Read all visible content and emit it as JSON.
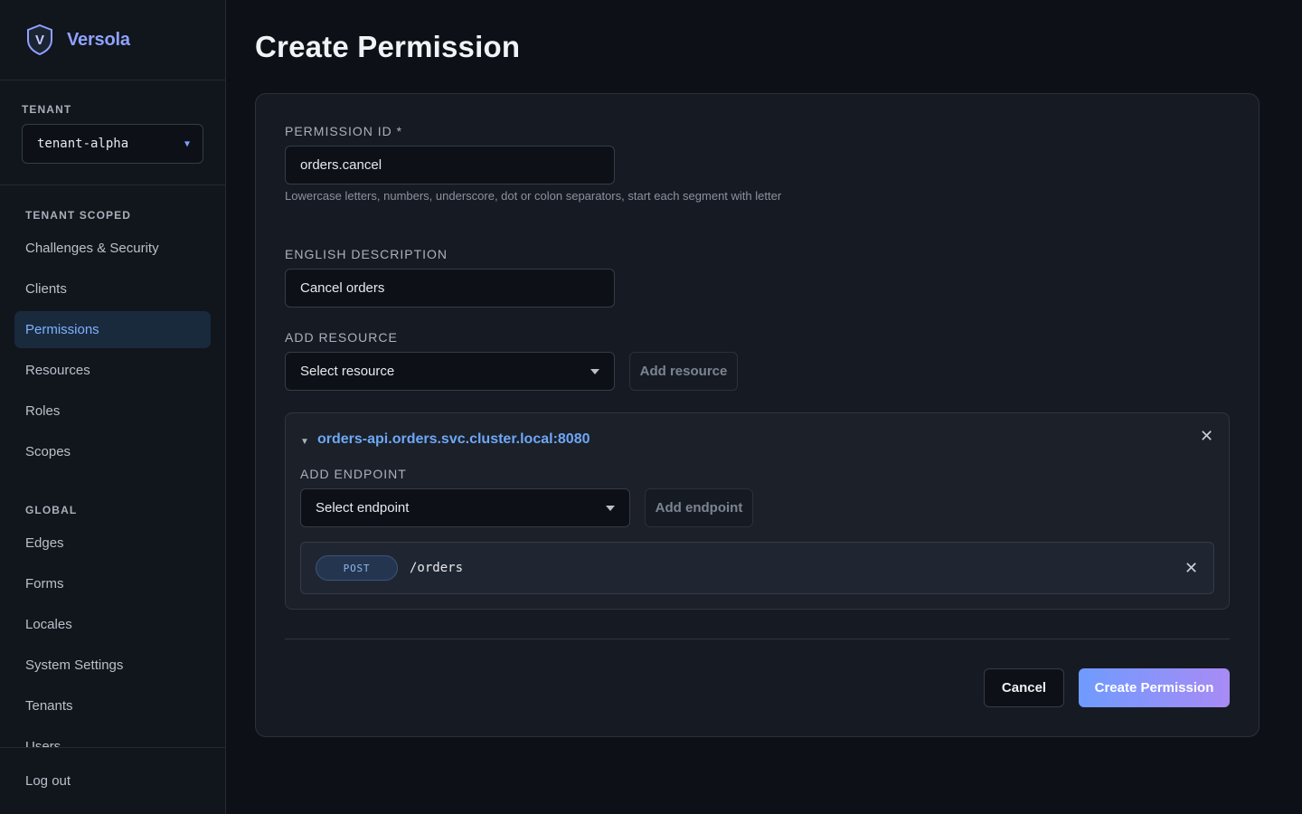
{
  "brand": {
    "name": "Versola",
    "logo_letter": "V",
    "accent": "#8ea2ff"
  },
  "tenant": {
    "label": "TENANT",
    "selected": "tenant-alpha"
  },
  "sidebar": {
    "scoped_label": "TENANT SCOPED",
    "scoped_items": [
      {
        "label": "Challenges & Security"
      },
      {
        "label": "Clients"
      },
      {
        "label": "Permissions",
        "active": true
      },
      {
        "label": "Resources"
      },
      {
        "label": "Roles"
      },
      {
        "label": "Scopes"
      }
    ],
    "global_label": "GLOBAL",
    "global_items": [
      {
        "label": "Edges"
      },
      {
        "label": "Forms"
      },
      {
        "label": "Locales"
      },
      {
        "label": "System Settings"
      },
      {
        "label": "Tenants"
      },
      {
        "label": "Users"
      }
    ],
    "logout_label": "Log out"
  },
  "page": {
    "title": "Create Permission"
  },
  "form": {
    "permission_id": {
      "label": "PERMISSION ID *",
      "value": "orders.cancel",
      "hint": "Lowercase letters, numbers, underscore, dot or colon separators, start each segment with letter"
    },
    "description": {
      "label": "ENGLISH DESCRIPTION",
      "value": "Cancel orders"
    },
    "add_resource": {
      "label": "ADD RESOURCE",
      "placeholder": "Select resource",
      "button": "Add resource"
    },
    "resource": {
      "title": "orders-api.orders.svc.cluster.local:8080",
      "add_endpoint_label": "ADD ENDPOINT",
      "endpoint_placeholder": "Select endpoint",
      "add_endpoint_button": "Add endpoint",
      "endpoints": [
        {
          "method": "POST",
          "path": "/orders"
        }
      ]
    },
    "cancel_label": "Cancel",
    "submit_label": "Create Permission"
  }
}
